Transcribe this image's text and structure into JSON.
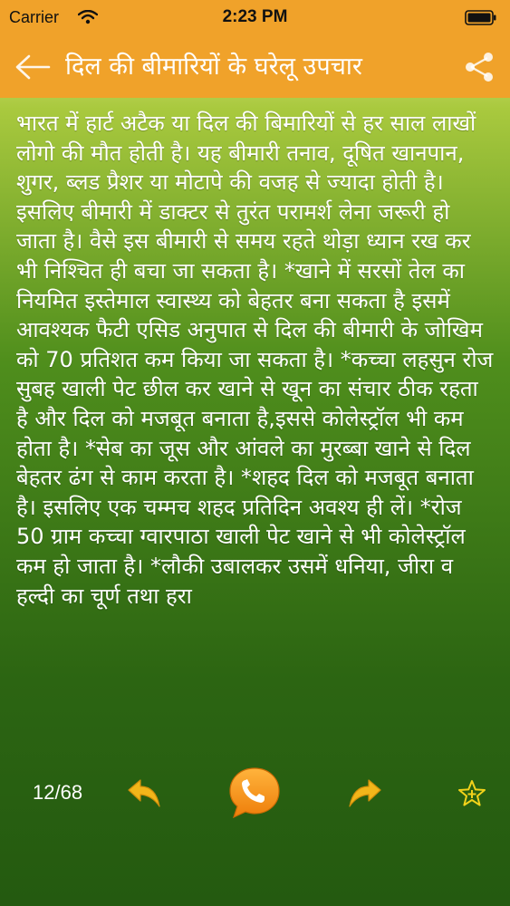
{
  "status_bar": {
    "carrier": "Carrier",
    "time": "2:23 PM"
  },
  "nav": {
    "title": "दिल की बीमारियों के घरेलू उपचार",
    "back_icon": "arrow-left-icon",
    "share_icon": "share-icon"
  },
  "article": {
    "body": "भारत में हार्ट अटैक या दिल की बिमारियों से हर साल लाखों लोगो की मौत होती है। यह बीमारी तनाव, दूषित खानपान, शुगर, ब्लड प्रैशर या मोटापे की वजह से ज्यादा होती है। इसलिए बीमारी में डाक्टर से तुरंत परामर्श लेना जरूरी हो जाता है। वैसे इस बीमारी से समय रहते थोड़ा ध्यान रख कर भी निश्चित ही बचा जा सकता है। *खाने में सरसों तेल का नियमित इस्तेमाल स्वास्थ्य को बेहतर बना सकता है इसमें आवश्यक फैटी एसिड अनुपात से दिल की बीमारी के जोखिम को 70 प्रतिशत कम किया जा सकता है। *कच्चा लहसुन रोज सुबह खाली पेट छील कर खाने से खून का संचार ठीक रहता है और दिल को मजबूत बनाता है,इससे कोलेस्ट्रॉल भी कम होता है। *सेब का जूस और आंवले का मुरब्बा खाने से दिल बेहतर ढंग से काम करता है। *शहद दिल को मजबूत बनाता है। इसलिए एक चम्मच शहद प्रतिदिन अवश्य ही लें। *रोज 50 ग्राम कच्चा ग्वारपाठा खाली पेट खाने से भी कोलेस्ट्रॉल कम हो जाता है। *लौकी उबालकर उसमें धनिया, जीरा व हल्दी का चूर्ण तथा हरा"
  },
  "footer": {
    "page_counter": "12/68",
    "prev_icon": "curved-arrow-left-icon",
    "call_icon": "phone-chat-icon",
    "next_icon": "curved-arrow-right-icon",
    "favorite_icon": "star-plus-icon"
  },
  "colors": {
    "accent": "#F0A22A",
    "arrow_yellow": "#F2B61A",
    "call_orange": "#F59A1B",
    "text": "#FFFFFF"
  }
}
